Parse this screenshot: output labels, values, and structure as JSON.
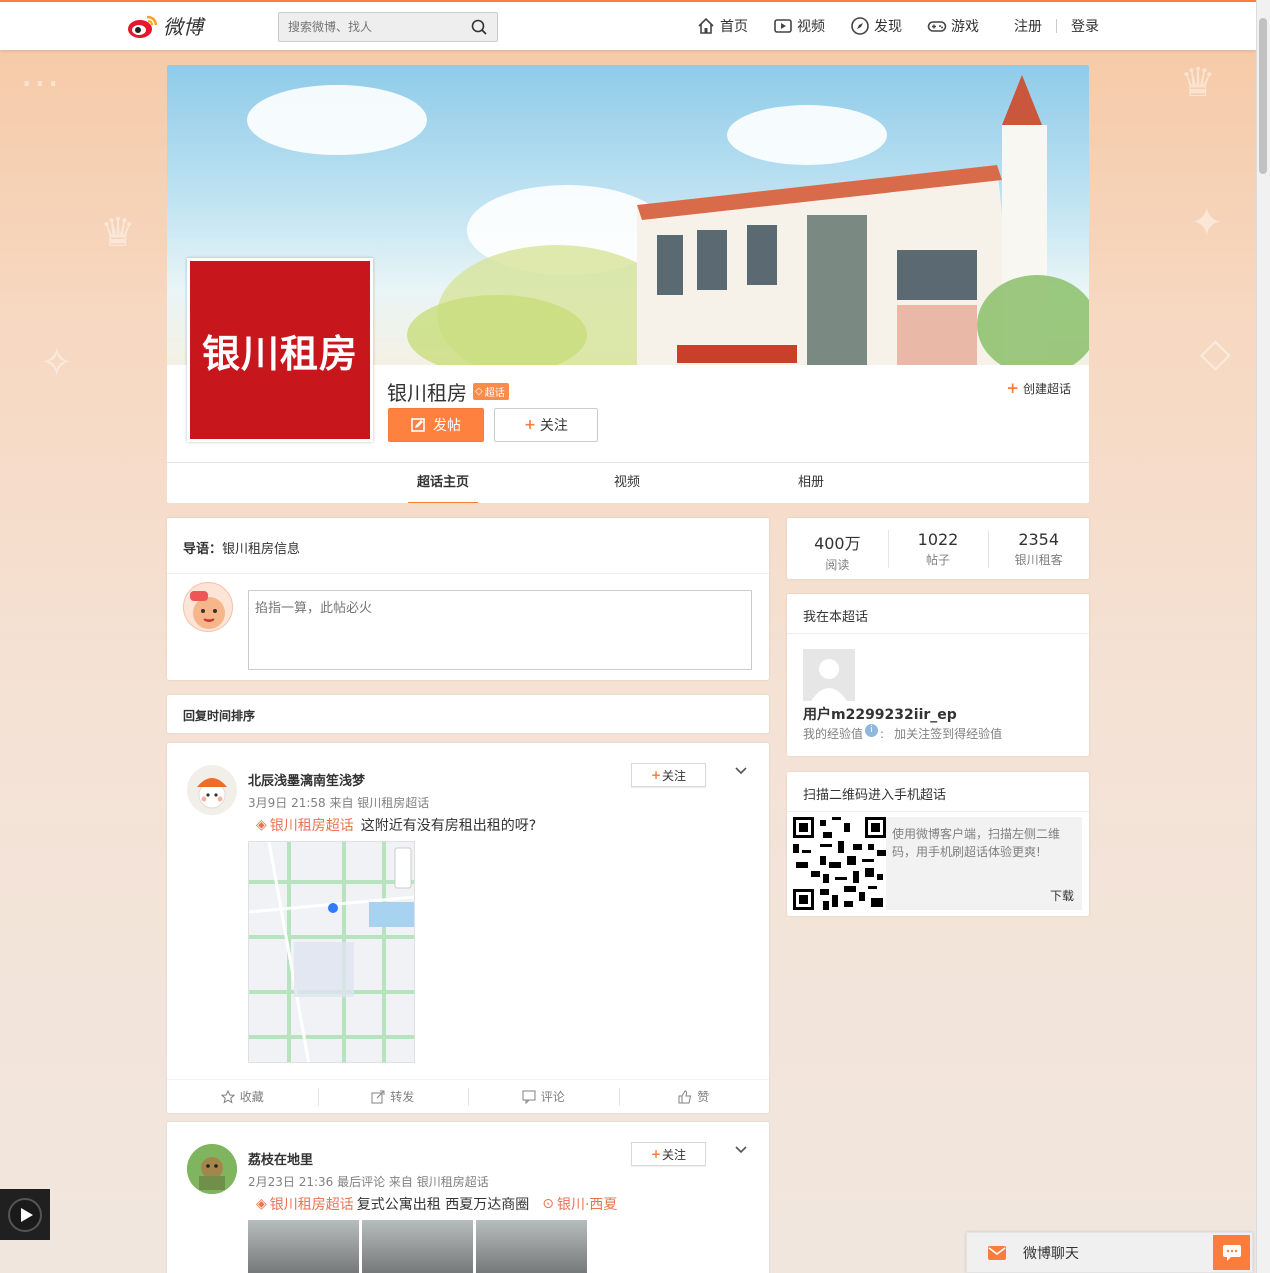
{
  "colors": {
    "accent": "#fa7d3c",
    "topic_link": "#eb7350",
    "avatar_red": "#c8161d"
  },
  "topbar": {
    "logo_text": "微博",
    "search_placeholder": "搜索微博、找人",
    "nav": [
      {
        "label": "首页",
        "icon": "home-icon"
      },
      {
        "label": "视频",
        "icon": "video-icon"
      },
      {
        "label": "发现",
        "icon": "compass-icon"
      },
      {
        "label": "游戏",
        "icon": "gamepad-icon"
      }
    ],
    "register": "注册",
    "login": "登录"
  },
  "header": {
    "avatar_text": "银川租房",
    "title": "银川租房",
    "badge": "超话",
    "create_label": "创建超话",
    "post_button": "发帖",
    "follow_button": "关注",
    "tabs": [
      "超话主页",
      "视频",
      "相册"
    ]
  },
  "guide": {
    "label": "导语：",
    "text": "银川租房信息",
    "input_placeholder": "掐指一算，此帖必火"
  },
  "sort": {
    "label": "回复时间排序"
  },
  "posts": [
    {
      "user": "北辰浅墨漓南笙浅梦",
      "meta": "3月9日 21:58 来自 银川租房超话",
      "topic": "银川租房超话",
      "text": "这附近有没有房租出租的呀?",
      "follow": "关注",
      "actions": [
        "收藏",
        "转发",
        "评论",
        "赞"
      ]
    },
    {
      "user": "荔枝在地里",
      "meta": "2月23日 21:36 最后评论 来自 银川租房超话",
      "topic": "银川租房超话",
      "text": "复式公寓出租 西夏万达商圈",
      "location": "银川·西夏",
      "follow": "关注"
    }
  ],
  "stats": [
    {
      "num": "400万",
      "label": "阅读"
    },
    {
      "num": "1022",
      "label": "帖子"
    },
    {
      "num": "2354",
      "label": "银川租客"
    }
  ],
  "me": {
    "title": "我在本超话",
    "username": "用户m2299232iir_ep",
    "exp_label": "我的经验值",
    "exp_hint": "加关注签到得经验值"
  },
  "qr": {
    "title": "扫描二维码进入手机超话",
    "desc": "使用微博客户端，扫描左侧二维码，用手机刷超话体验更爽!",
    "download": "下载"
  },
  "chat": {
    "label": "微博聊天"
  }
}
